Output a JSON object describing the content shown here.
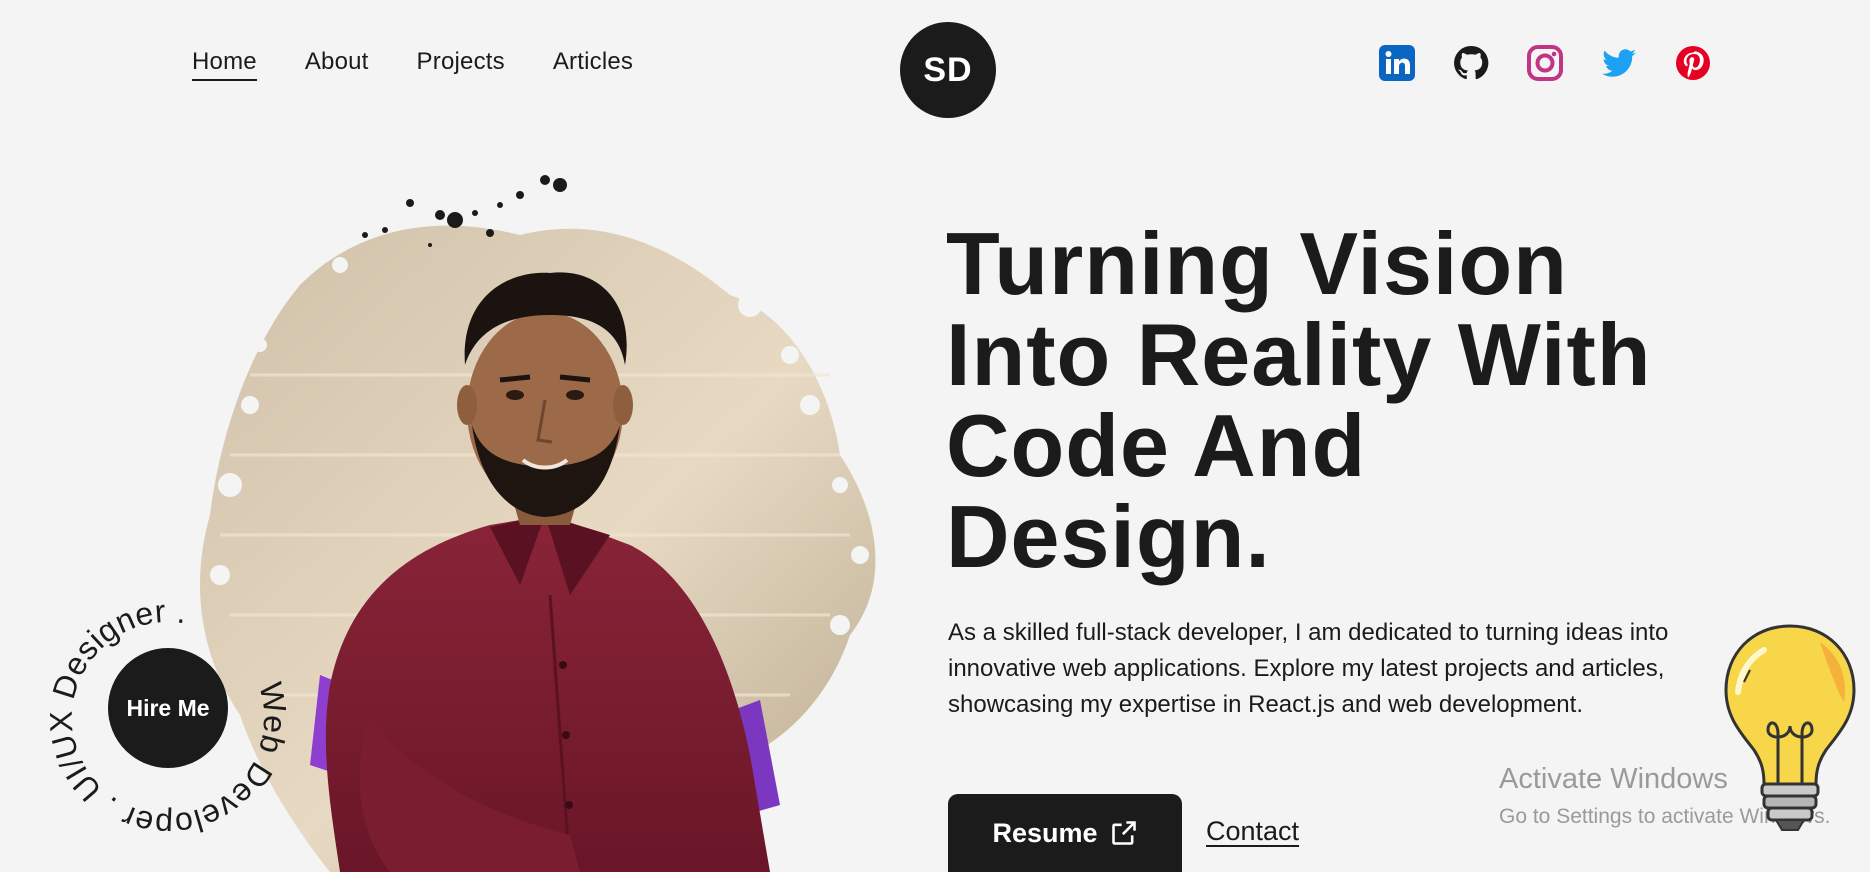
{
  "nav": {
    "links": [
      {
        "label": "Home",
        "active": true
      },
      {
        "label": "About",
        "active": false
      },
      {
        "label": "Projects",
        "active": false
      },
      {
        "label": "Articles",
        "active": false
      }
    ],
    "logo": "SD",
    "socials": [
      {
        "icon": "linkedin-icon",
        "color": "#0a66c2"
      },
      {
        "icon": "github-icon",
        "color": "#1b1b1b"
      },
      {
        "icon": "instagram-icon",
        "color": "#c13584"
      },
      {
        "icon": "twitter-icon",
        "color": "#1da1f2"
      },
      {
        "icon": "pinterest-icon",
        "color": "#e60023"
      }
    ]
  },
  "badge": {
    "circular_text": "Web Developer . UI/UX Designer . ",
    "button": "Hire Me"
  },
  "hero": {
    "headline": "Turning Vision Into Reality With Code And Design.",
    "intro": "As a skilled full-stack developer, I am dedicated to turning ideas into innovative web applications. Explore my latest projects and articles, showcasing my expertise in React.js and web development.",
    "resume_label": "Resume",
    "contact_label": "Contact"
  },
  "watermark": {
    "title": "Activate Windows",
    "subtitle": "Go to Settings to activate Windows."
  },
  "colors": {
    "background": "#f4f4f4",
    "dark": "#1b1b1b",
    "shirt": "#7b1f33"
  }
}
